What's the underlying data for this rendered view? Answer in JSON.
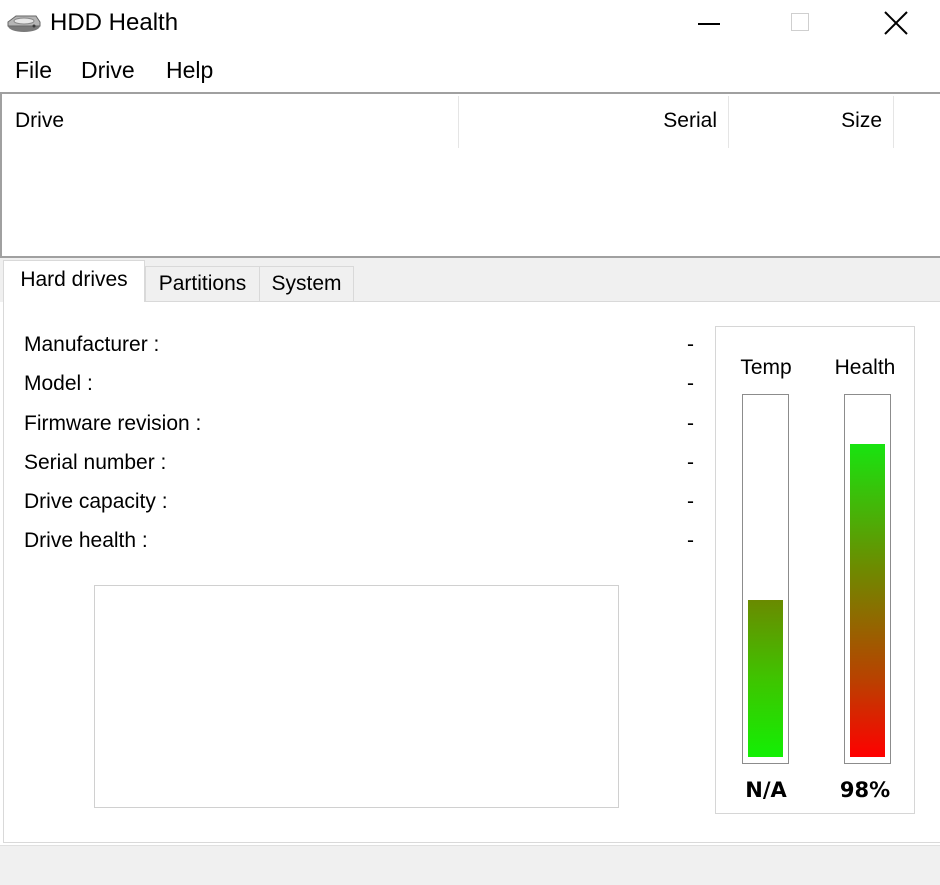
{
  "window": {
    "title": "HDD Health",
    "icon": "hard-drive-icon"
  },
  "menu": {
    "file": "File",
    "drive": "Drive",
    "help": "Help"
  },
  "drive_list": {
    "columns": {
      "drive": "Drive",
      "serial": "Serial",
      "size": "Size"
    },
    "rows": []
  },
  "tabs": {
    "hard_drives": "Hard drives",
    "partitions": "Partitions",
    "system": "System",
    "active": "Hard drives"
  },
  "info": {
    "manufacturer": {
      "label": "Manufacturer :",
      "value": "-"
    },
    "model": {
      "label": "Model :",
      "value": "-"
    },
    "firmware": {
      "label": "Firmware revision :",
      "value": "-"
    },
    "serial": {
      "label": "Serial number :",
      "value": "-"
    },
    "capacity": {
      "label": "Drive capacity :",
      "value": "-"
    },
    "health": {
      "label": "Drive health :",
      "value": "-"
    }
  },
  "gauges": {
    "temp": {
      "label": "Temp",
      "value": "N/A",
      "level_percent": 44
    },
    "health": {
      "label": "Health",
      "value": "98%",
      "level_percent": 88
    }
  },
  "colors": {
    "temp_top": "#6a8a00",
    "temp_bottom": "#13ef04",
    "health_top": "#18e410",
    "health_bottom": "#ff0000"
  }
}
